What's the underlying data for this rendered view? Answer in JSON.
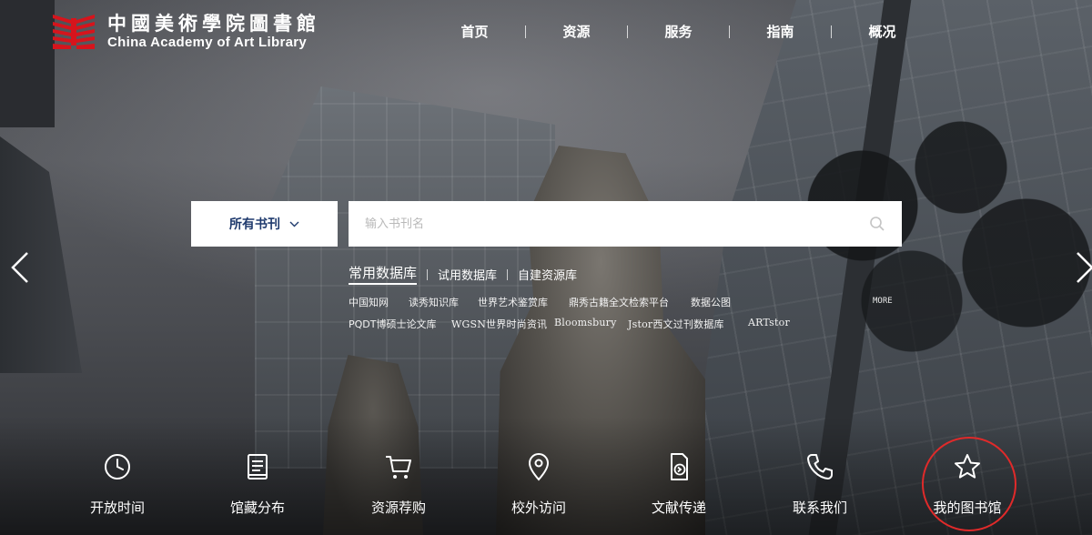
{
  "header": {
    "logo_cn": "中國美術學院圖書館",
    "logo_en": "China Academy of Art Library",
    "brand_color": "#d6141c",
    "nav": [
      {
        "label": "首页"
      },
      {
        "label": "资源"
      },
      {
        "label": "服务"
      },
      {
        "label": "指南"
      },
      {
        "label": "概况"
      }
    ]
  },
  "search": {
    "scope_label": "所有书刊",
    "placeholder": "输入书刊名",
    "icon": "search-icon"
  },
  "databases": {
    "tabs": [
      {
        "label": "常用数据库",
        "active": true
      },
      {
        "label": "试用数据库",
        "active": false
      },
      {
        "label": "自建资源库",
        "active": false
      }
    ],
    "row1": [
      "中国知网",
      "读秀知识库",
      "世界艺术鉴赏库",
      "鼎秀古籍全文检索平台",
      "数据公图"
    ],
    "row2": [
      "PQDT博硕士论文库",
      "WGSN世界时尚资讯",
      "Bloomsbury",
      "Jstor西文过刊数据库",
      "ARTstor"
    ],
    "more_label": "MORE"
  },
  "carousel": {
    "prev_icon": "chevron-left-icon",
    "next_icon": "chevron-right-icon"
  },
  "quick_links": [
    {
      "label": "开放时间",
      "icon": "clock-icon"
    },
    {
      "label": "馆藏分布",
      "icon": "book-icon"
    },
    {
      "label": "资源荐购",
      "icon": "cart-icon"
    },
    {
      "label": "校外访问",
      "icon": "location-pin-icon"
    },
    {
      "label": "文献传递",
      "icon": "document-transfer-icon"
    },
    {
      "label": "联系我们",
      "icon": "phone-icon"
    },
    {
      "label": "我的图书馆",
      "icon": "star-icon"
    }
  ],
  "highlight_color": "#e02a2a"
}
